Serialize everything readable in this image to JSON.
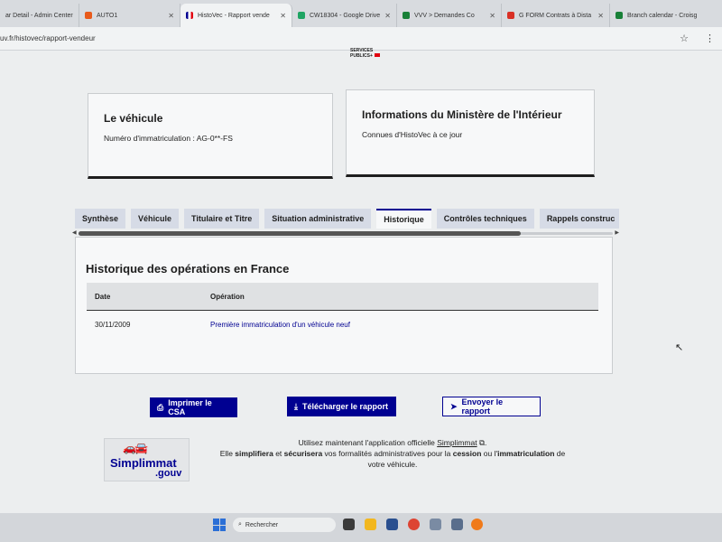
{
  "browser": {
    "tabs": [
      {
        "title": "ar Detail - Admin Center",
        "color": "#888888",
        "active": false
      },
      {
        "title": "AUTO1",
        "color": "#e85a1b",
        "active": false
      },
      {
        "title": "HistoVec - Rapport vende",
        "color": "#000091",
        "active": true
      },
      {
        "title": "CW18304 - Google Drive",
        "color": "#1fa463",
        "active": false
      },
      {
        "title": "VVV > Demandes Co",
        "color": "#188038",
        "active": false
      },
      {
        "title": "G FORM Contrats à Dista",
        "color": "#d93025",
        "active": false
      },
      {
        "title": "Branch calendar - Croisg",
        "color": "#188038",
        "active": false
      }
    ],
    "url": "uv.fr/histovec/rapport-vendeur"
  },
  "header": {
    "logo_line1": "SERVICES",
    "logo_line2": "PUBLICS+"
  },
  "vehicle_card": {
    "title": "Le véhicule",
    "text": "Numéro d'immatriculation : AG-0**-FS"
  },
  "ministry_card": {
    "title": "Informations du Ministère de l'Intérieur",
    "text": "Connues d'HistoVec à ce jour"
  },
  "page_tabs": [
    "Synthèse",
    "Véhicule",
    "Titulaire et Titre",
    "Situation administrative",
    "Historique",
    "Contrôles techniques",
    "Rappels construc"
  ],
  "active_tab": "Historique",
  "history": {
    "title": "Historique des opérations en France",
    "columns": [
      "Date",
      "Opération"
    ],
    "rows": [
      {
        "date": "30/11/2009",
        "operation": "Première immatriculation d'un véhicule neuf"
      }
    ]
  },
  "actions": {
    "print": "Imprimer le CSA",
    "download": "Télécharger le rapport",
    "send": "Envoyer le rapport"
  },
  "simplimmat": {
    "logo_name": "Simplimmat",
    "logo_suffix": ".gouv",
    "line1_before": "Utilisez maintenant l'application officielle ",
    "line1_link": "Simplimmat",
    "line1_after": ".",
    "line2_a": "Elle ",
    "line2_b": "simplifiera",
    "line2_c": " et ",
    "line2_d": "sécurisera",
    "line2_e": " vos formalités administratives pour la ",
    "line2_f": "cession",
    "line2_g": " ou l'",
    "line2_h": "immatriculation",
    "line2_i": " de",
    "line3": "votre véhicule."
  },
  "taskbar": {
    "search_placeholder": "Rechercher"
  }
}
